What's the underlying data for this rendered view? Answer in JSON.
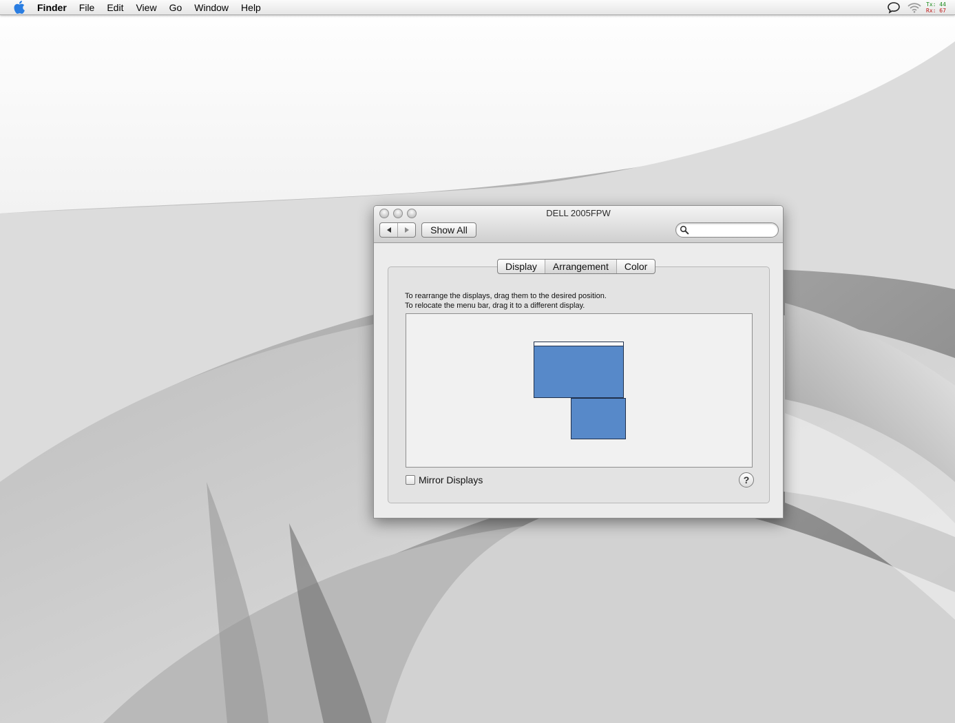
{
  "menubar": {
    "apple_icon": "apple-icon",
    "app_name": "Finder",
    "items": [
      "File",
      "Edit",
      "View",
      "Go",
      "Window",
      "Help"
    ],
    "status": {
      "chat_icon": "speech-bubble-icon",
      "wifi_icon": "wifi-icon",
      "tx_label": "Tx:",
      "tx_value": "44",
      "rx_label": "Rx:",
      "rx_value": "67"
    }
  },
  "window": {
    "title": "DELL 2005FPW",
    "back_icon": "back-arrow-icon",
    "forward_icon": "forward-arrow-icon",
    "show_all_label": "Show All",
    "search": {
      "value": "",
      "placeholder": "",
      "icon": "magnifier-icon"
    },
    "tabs": [
      {
        "label": "Display",
        "selected": false
      },
      {
        "label": "Arrangement",
        "selected": true
      },
      {
        "label": "Color",
        "selected": false
      }
    ],
    "instructions": {
      "line1": "To rearrange the displays, drag them to the desired position.",
      "line2": "To relocate the menu bar, drag it to a different display."
    },
    "mirror_label": "Mirror Displays",
    "mirror_checked": false,
    "help_label": "?",
    "display_color": "#5789c9"
  }
}
